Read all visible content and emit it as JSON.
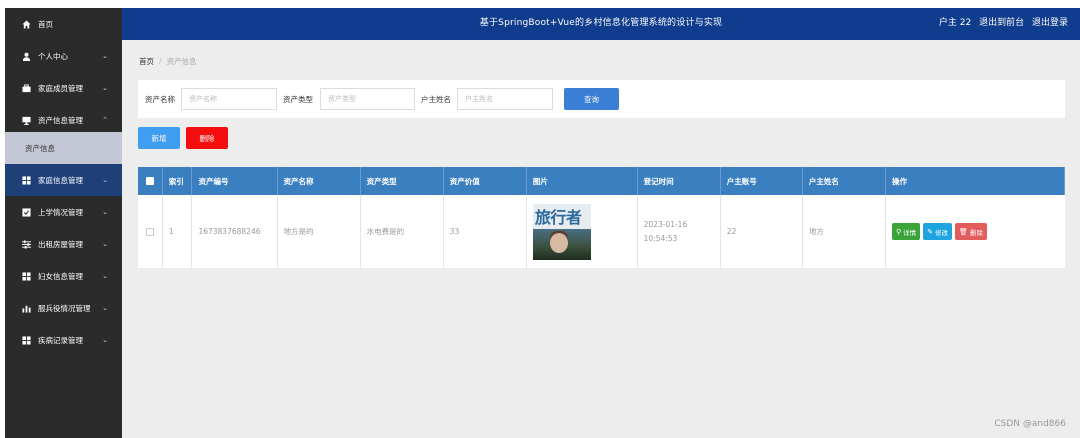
{
  "sidebar": {
    "items": [
      {
        "label": "首页",
        "icon": "home-icon"
      },
      {
        "label": "个人中心",
        "icon": "user-icon"
      },
      {
        "label": "家庭成员管理",
        "icon": "briefcase-icon"
      },
      {
        "label": "资产信息管理",
        "icon": "monitor-icon"
      },
      {
        "label": "家庭信息管理",
        "icon": "grid-icon"
      },
      {
        "label": "上学情况管理",
        "icon": "checklist-icon"
      },
      {
        "label": "出租房屋管理",
        "icon": "sliders-icon"
      },
      {
        "label": "妇女信息管理",
        "icon": "grid-icon"
      },
      {
        "label": "服兵役情况管理",
        "icon": "bar-chart-icon"
      },
      {
        "label": "疾病记录管理",
        "icon": "grid-icon"
      }
    ],
    "sub_item": "资产信息"
  },
  "header": {
    "title": "基于SpringBoot+Vue的乡村信息化管理系统的设计与实现",
    "user": "户主 22",
    "back_to_front": "退出到前台",
    "logout": "退出登录"
  },
  "breadcrumb": {
    "home": "首页",
    "separator": "/",
    "current": "资产信息"
  },
  "search": {
    "name_label": "资产名称",
    "name_placeholder": "资产名称",
    "type_label": "资产类型",
    "type_placeholder": "资产类型",
    "owner_label": "户主姓名",
    "owner_placeholder": "户主姓名",
    "query_button": "查询"
  },
  "actions": {
    "add": "新增",
    "delete": "删除"
  },
  "table": {
    "columns": [
      "索引",
      "资产编号",
      "资产名称",
      "资产类型",
      "资产价值",
      "图片",
      "登记时间",
      "户主账号",
      "户主姓名",
      "操作"
    ],
    "rows": [
      {
        "index": "1",
        "asset_no": "1673837688246",
        "asset_name": "地方是的",
        "asset_type": "水电费是的",
        "asset_value": "33",
        "image_text": "旅行者",
        "reg_time": "2023-01-16 10:54:53",
        "owner_account": "22",
        "owner_name": "地方"
      }
    ],
    "op_buttons": {
      "detail": "详情",
      "edit": "修改",
      "delete": "删除"
    }
  },
  "watermark": "CSDN @and866",
  "colors": {
    "sidebar_bg": "#2b2b2b",
    "sidebar_active": "#1f3f78",
    "header_bg": "#0f3c8c",
    "table_header": "#3a7fc0",
    "query_button": "#3a7fd5",
    "add_button": "#3f9ef2",
    "delete_button": "#f50e0e",
    "detail_button": "#3aa33a",
    "edit_button": "#1fa4e0",
    "row_delete_button": "#e25c5c"
  }
}
